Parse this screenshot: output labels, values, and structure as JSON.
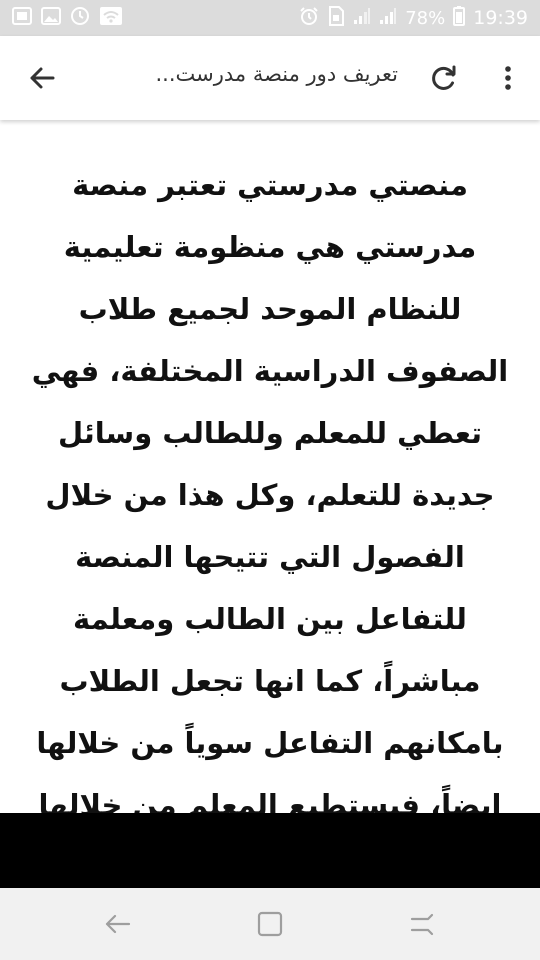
{
  "status_bar": {
    "battery": "78%",
    "time": "19:39",
    "icons": [
      "gallery-icon",
      "image-icon",
      "sync-icon",
      "wifi-icon",
      "alarm-icon",
      "sim-icon",
      "signal-icon",
      "signal-icon",
      "battery-icon"
    ]
  },
  "app_bar": {
    "title": "تعريف دور منصة مدرست...",
    "back_icon": "arrow-back-icon",
    "refresh_icon": "refresh-icon",
    "menu_icon": "more-vert-icon"
  },
  "article": {
    "text": "منصتي مدرستي تعتبر منصة مدرستي هي منظومة تعليمية للنظام الموحد لجميع طلاب الصفوف الدراسية المختلفة، فهي تعطي للمعلم وللطالب وسائل جديدة للتعلم، وكل هذا من خلال الفصول التي تتيحها المنصة للتفاعل بين الطالب ومعلمة مباشراً، كما انها تجعل الطلاب بامكانهم التفاعل سوياً من خلالها ايضاً، فيستطيع المعلم من خلالها اعطاء الانشطة اليومية للطلاب، وتقييم المستوي التعليمي"
  },
  "nav_bar": {
    "icons": [
      "back-nav-icon",
      "recents-icon",
      "switch-apps-icon"
    ]
  },
  "colors": {
    "status_bar": "#dcdcdc",
    "app_bar": "#ffffff",
    "text": "#111111",
    "nav_bar": "#f1f1f1",
    "band": "#000000"
  }
}
